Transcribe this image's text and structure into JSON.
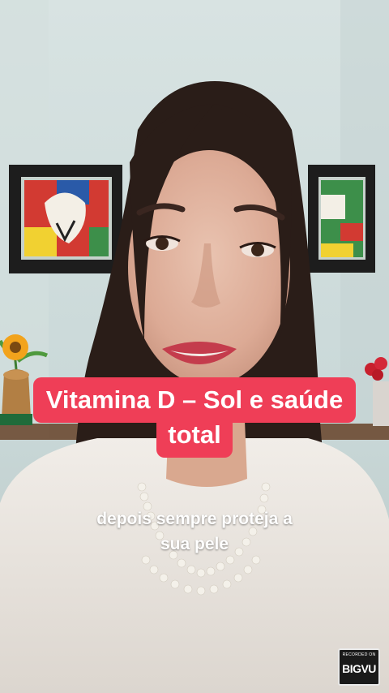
{
  "video": {
    "title_line1": "Vitamina D – Sol e saúde",
    "title_line2": "total",
    "caption_line1": "depois sempre proteja a",
    "caption_line2": "sua pele"
  },
  "watermark": {
    "recorded_on": "RECORDED ON",
    "brand": "BIGVU"
  },
  "colors": {
    "title_bg": "#ef3e57",
    "wall": "#cfdcdc",
    "hair": "#2a1d18",
    "sweater": "#ece8e2"
  }
}
